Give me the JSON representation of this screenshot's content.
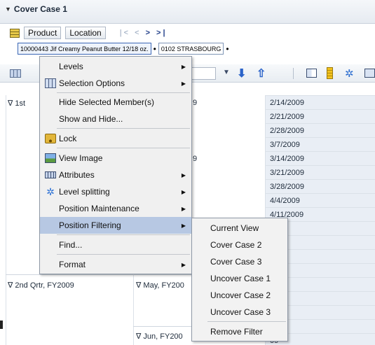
{
  "header": {
    "title": "Cover Case 1"
  },
  "tabs": {
    "product": "Product",
    "location": "Location"
  },
  "filters": {
    "product_value": "10000443 Jif Creamy Peanut Butter 12/18 oz.",
    "location_value": "0102 STRASBOURG"
  },
  "grid": {
    "quarter1": "∇ 1st",
    "quarter2": "∇ 2nd Qrtr, FY2009",
    "month_may": "∇ May, FY200",
    "month_jun": "∇ Jun, FY200",
    "month_fragment_1": "9",
    "month_fragment_2": "9",
    "dates": [
      "2/14/2009",
      "2/21/2009",
      "2/28/2009",
      "3/7/2009",
      "3/14/2009",
      "3/21/2009",
      "3/28/2009",
      "4/4/2009",
      "4/11/2009",
      "09",
      "09",
      "9",
      "9",
      "09",
      "09",
      "09",
      "9",
      "09"
    ]
  },
  "context_menu": {
    "items": [
      {
        "label": "Levels",
        "submenu": true
      },
      {
        "label": "Selection Options",
        "submenu": true
      },
      {
        "label": "Hide Selected Member(s)"
      },
      {
        "label": "Show and Hide..."
      },
      {
        "label": "Lock"
      },
      {
        "label": "View Image"
      },
      {
        "label": "Attributes",
        "submenu": true
      },
      {
        "label": "Level splitting",
        "submenu": true
      },
      {
        "label": "Position Maintenance",
        "submenu": true
      },
      {
        "label": "Position Filtering",
        "submenu": true,
        "highlighted": true
      },
      {
        "label": "Find..."
      },
      {
        "label": "Format",
        "submenu": true
      }
    ]
  },
  "submenu": {
    "items": [
      "Current View",
      "Cover Case 2",
      "Cover Case 3",
      "Uncover Case 1",
      "Uncover Case 2",
      "Uncover Case 3",
      "Remove Filter"
    ]
  },
  "colors": {
    "highlight": "#b7c8e3",
    "date_cell_bg": "#e9eef5",
    "accent_blue": "#2b63c9"
  }
}
